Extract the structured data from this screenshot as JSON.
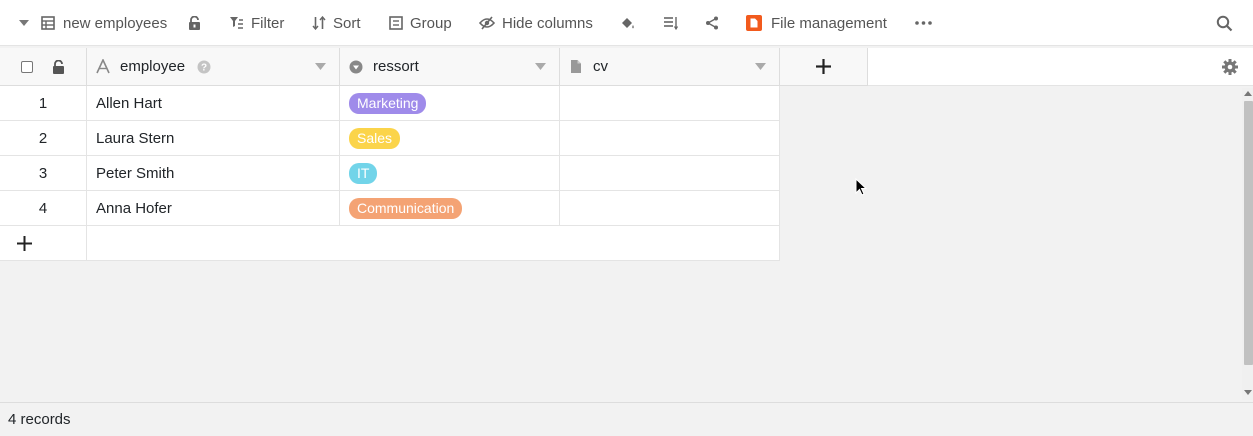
{
  "toolbar": {
    "view_name": "new employees",
    "filter_label": "Filter",
    "sort_label": "Sort",
    "group_label": "Group",
    "hide_columns_label": "Hide columns",
    "file_management_label": "File management"
  },
  "columns": [
    {
      "name": "employee",
      "icon": "text-icon"
    },
    {
      "name": "ressort",
      "icon": "single-select-icon"
    },
    {
      "name": "cv",
      "icon": "file-icon"
    }
  ],
  "rows": [
    {
      "index": "1",
      "employee": "Allen Hart",
      "ressort": "Marketing",
      "ressort_color": "#9f8bea"
    },
    {
      "index": "2",
      "employee": "Laura Stern",
      "ressort": "Sales",
      "ressort_color": "#fbd44a"
    },
    {
      "index": "3",
      "employee": "Peter Smith",
      "ressort": "IT",
      "ressort_color": "#72d4e9"
    },
    {
      "index": "4",
      "employee": "Anna Hofer",
      "ressort": "Communication",
      "ressort_color": "#f4a374"
    }
  ],
  "footer": {
    "records": "4 records"
  },
  "colors": {
    "accent": "#ff8000",
    "file_mgmt_icon": "#f25a1d"
  }
}
